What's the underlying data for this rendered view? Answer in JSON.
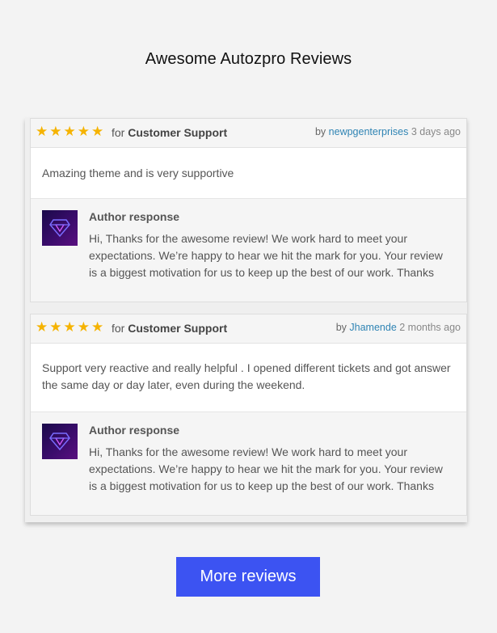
{
  "page": {
    "title": "Awesome Autozpro Reviews"
  },
  "reviews": [
    {
      "stars": 5,
      "star_color": "#f5b301",
      "for_prefix": "for",
      "category": "Customer Support",
      "by_prefix": "by",
      "username": "newpgenterprises",
      "time_ago": "3 days ago",
      "body": "Amazing theme and is very supportive",
      "response_title": "Author response",
      "response_text": "Hi, Thanks for the awesome review! We work hard to meet your expectations. We’re happy to hear we hit the mark for you. Your review is a biggest motivation for us to keep up the best of our work. Thanks",
      "avatar_icon": "diamond-logo-icon"
    },
    {
      "stars": 5,
      "star_color": "#f5b301",
      "for_prefix": "for",
      "category": "Customer Support",
      "by_prefix": "by",
      "username": "Jhamende",
      "time_ago": "2 months ago",
      "body": "Support very reactive and really helpful . I opened different tickets and got answer the same day or day later, even during the weekend.",
      "response_title": "Author response",
      "response_text": "Hi, Thanks for the awesome review! We work hard to meet your expectations. We’re happy to hear we hit the mark for you. Your review is a biggest motivation for us to keep up the best of our work. Thanks",
      "avatar_icon": "diamond-logo-icon"
    }
  ],
  "more_button": {
    "label": "More reviews",
    "color": "#3c53f2"
  },
  "colors": {
    "link": "#2f84b4",
    "background": "#f3f3f3"
  }
}
